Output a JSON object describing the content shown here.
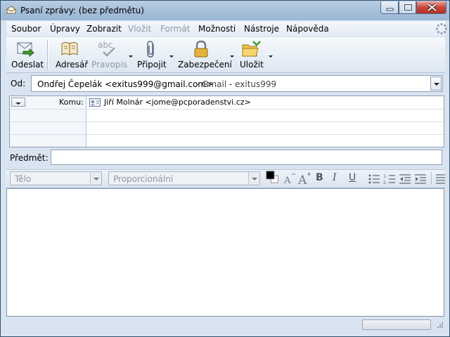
{
  "window": {
    "title": "Psaní zprávy: (bez předmětu)"
  },
  "menu": [
    {
      "label": "Soubor",
      "disabled": false
    },
    {
      "label": "Úpravy",
      "disabled": false
    },
    {
      "label": "Zobrazit",
      "disabled": false
    },
    {
      "label": "Vložit",
      "disabled": true
    },
    {
      "label": "Formát",
      "disabled": true
    },
    {
      "label": "Možnosti",
      "disabled": false
    },
    {
      "label": "Nástroje",
      "disabled": false
    },
    {
      "label": "Nápověda",
      "disabled": false
    }
  ],
  "toolbar": {
    "send_label": "Odeslat",
    "addressbook_label": "Adresář",
    "spell_label": "Pravopis",
    "spell_icon_text": "abc",
    "attach_label": "Připojit",
    "security_label": "Zabezpečení",
    "save_label": "Uložit"
  },
  "header": {
    "from_label": "Od:",
    "from_value": "Ondřej Čepelák <exitus999@gmail.com>",
    "from_account": "- Gmail - exitus999",
    "recipients": [
      {
        "type": "Komu:",
        "value": "Jiří Molnár <jome@pcporadenstvi.cz>"
      }
    ],
    "subject_label": "Předmět:",
    "subject_value": ""
  },
  "format_bar": {
    "paragraph_value": "Tělo",
    "font_value": "Proporcionální",
    "bold_glyph": "B",
    "italic_glyph": "I",
    "underline_glyph": "U",
    "text_color": "#000000",
    "bg_color": "#ffffff"
  },
  "colors": {
    "titlebar": "#a5bed9",
    "chrome": "#dae4f0",
    "close_button": "#c7483b"
  }
}
